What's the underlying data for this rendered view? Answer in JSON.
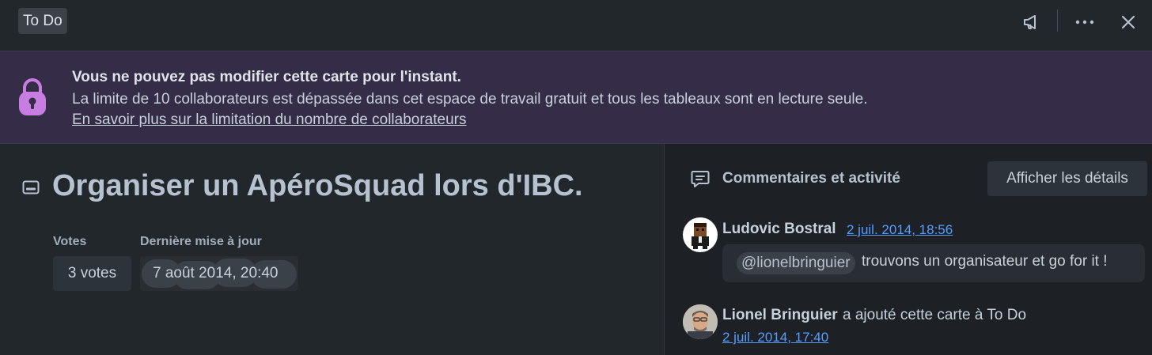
{
  "header": {
    "list_name": "To Do",
    "icons": [
      "megaphone-icon",
      "more-icon",
      "close-icon"
    ]
  },
  "banner": {
    "icon": "lock-icon",
    "title": "Vous ne pouvez pas modifier cette carte pour l'instant.",
    "text": "La limite de 10 collaborateurs est dépassée dans cet espace de travail gratuit et tous les tableaux sont en lecture seule.",
    "link": "En savoir plus sur la limitation du nombre de collaborateurs",
    "colors": {
      "background": "#352c48",
      "icon": "#c77ee0"
    }
  },
  "card": {
    "title": "Organiser un ApéroSquad lors d'IBC.",
    "votes_label": "Votes",
    "votes_value": "3 votes",
    "updated_label": "Dernière mise à jour",
    "updated_value": "7 août 2014, 20:40"
  },
  "activity": {
    "title": "Commentaires et activité",
    "details_button": "Afficher les détails",
    "items": [
      {
        "author": "Ludovic Bostral",
        "time": "2 juil. 2014, 18:56",
        "mention": "@lionelbringuier",
        "text": "trouvons un organisateur et go for it !"
      },
      {
        "author": "Lionel Bringuier",
        "action": "a ajouté cette carte à To Do",
        "time": "2 juil. 2014, 17:40"
      }
    ]
  },
  "colors": {
    "link": "#579dff",
    "page_bg": "#22272b",
    "panel_bg": "#1d2125"
  }
}
